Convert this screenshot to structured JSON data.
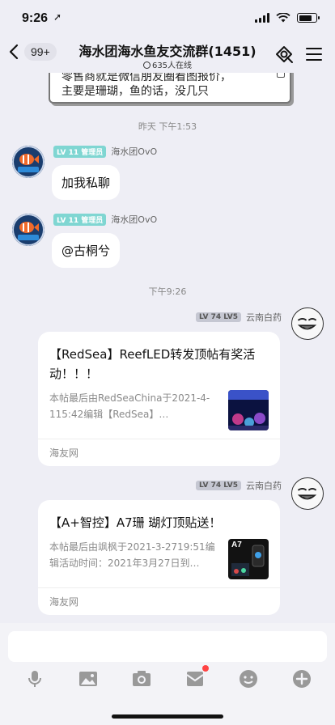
{
  "status": {
    "time": "9:26"
  },
  "header": {
    "unread_count": "99+",
    "title": "海水团海水鱼友交流群(1451)",
    "online": "635人在线"
  },
  "pinned_message": {
    "line1": "零售商就是微信朋友圈看图报价，",
    "line2": "主要是珊瑚，鱼的话，没几只"
  },
  "timestamps": {
    "yesterday": "昨天 下午1:53",
    "today": "下午9:26"
  },
  "messages": [
    {
      "level": "LV 11",
      "role": "管理员",
      "sender": "海水团OvO",
      "text": "加我私聊"
    },
    {
      "level": "LV 11",
      "role": "管理员",
      "sender": "海水团OvO",
      "text": "@古桐兮"
    }
  ],
  "shares": [
    {
      "level": "LV 74",
      "lv_label": "LV5",
      "sender": "云南白药",
      "title": "【RedSea】ReefLED转发顶帖有奖活动！！！",
      "desc": "本帖最后由RedSeaChina于2021-4-115:42编辑【RedSea】…",
      "source": "海友网"
    },
    {
      "level": "LV 74",
      "lv_label": "LV5",
      "sender": "云南白药",
      "title": "【A+智控】A7珊 瑚灯顶贴送！",
      "desc": "本帖最后由飒枫于2021-3-2719:51编辑活动时间：2021年3月27日到…",
      "source": "海友网",
      "thumb_label": "A7"
    }
  ],
  "toolbar": [
    "mic-icon",
    "image-icon",
    "camera-icon",
    "red-packet-icon",
    "emoji-icon",
    "plus-icon"
  ],
  "colors": {
    "background": "#eeeef5",
    "admin_tag": "#7fd6d2",
    "notification_dot": "#ff4444"
  }
}
